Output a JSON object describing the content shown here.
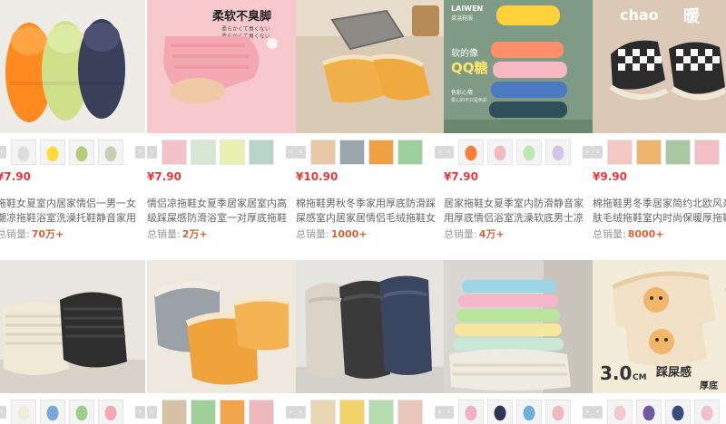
{
  "products": [
    {
      "price": "¥7.90",
      "title": "拖鞋女夏室内居家情侣一男一女潮凉拖鞋浴室洗澡托鞋静音家用拖鞋",
      "sales_label": "总销量:",
      "sales_value": "70万+"
    },
    {
      "price": "¥7.90",
      "title": "情侣凉拖鞋女夏季居家居室内高级踩屎感防滑浴室一对厚底拖鞋男款",
      "sales_label": "总销量:",
      "sales_value": "2万+",
      "image_text": [
        "柔软不臭脚",
        "柔らかくて臭くない",
        "柔らかくて臭くない"
      ]
    },
    {
      "price": "¥10.90",
      "title": "棉拖鞋男秋冬季家用厚底防滑踩屎感室内居家居情侣毛绒拖鞋女冬天",
      "sales_label": "总销量:",
      "sales_value": "1000+"
    },
    {
      "price": "¥7.90",
      "title": "居家拖鞋女夏季室内防滑静音家用厚底情侣浴室洗澡软底男士凉拖鞋",
      "sales_label": "总销量:",
      "sales_value": "4万+",
      "image_text": [
        "LAIWEN",
        "莱温鞋服",
        "软的像",
        "QQ糖",
        "色彩心情",
        "柔心的不只是色彩"
      ]
    },
    {
      "price": "¥9.90",
      "title": "棉拖鞋男冬季居家简约北欧风亲肤毛绒拖鞋室内时尚保暖厚拖鞋女",
      "sales_label": "总销量:",
      "sales_value": "8000+",
      "image_text": [
        "chao",
        "暖"
      ]
    },
    {
      "image_text": []
    },
    {
      "image_text": []
    },
    {
      "image_text": []
    },
    {
      "image_text": []
    },
    {
      "image_text": [
        "3.0",
        "CM",
        "踩屎感",
        "厚底"
      ]
    }
  ],
  "colors": {
    "price": "#e4393c",
    "sales_value": "#d0653a",
    "title": "#666666",
    "sales_label": "#999999",
    "arrow": "#d9d9d9"
  },
  "icons": {
    "prev": "chevron-left-icon",
    "next": "chevron-right-icon"
  }
}
